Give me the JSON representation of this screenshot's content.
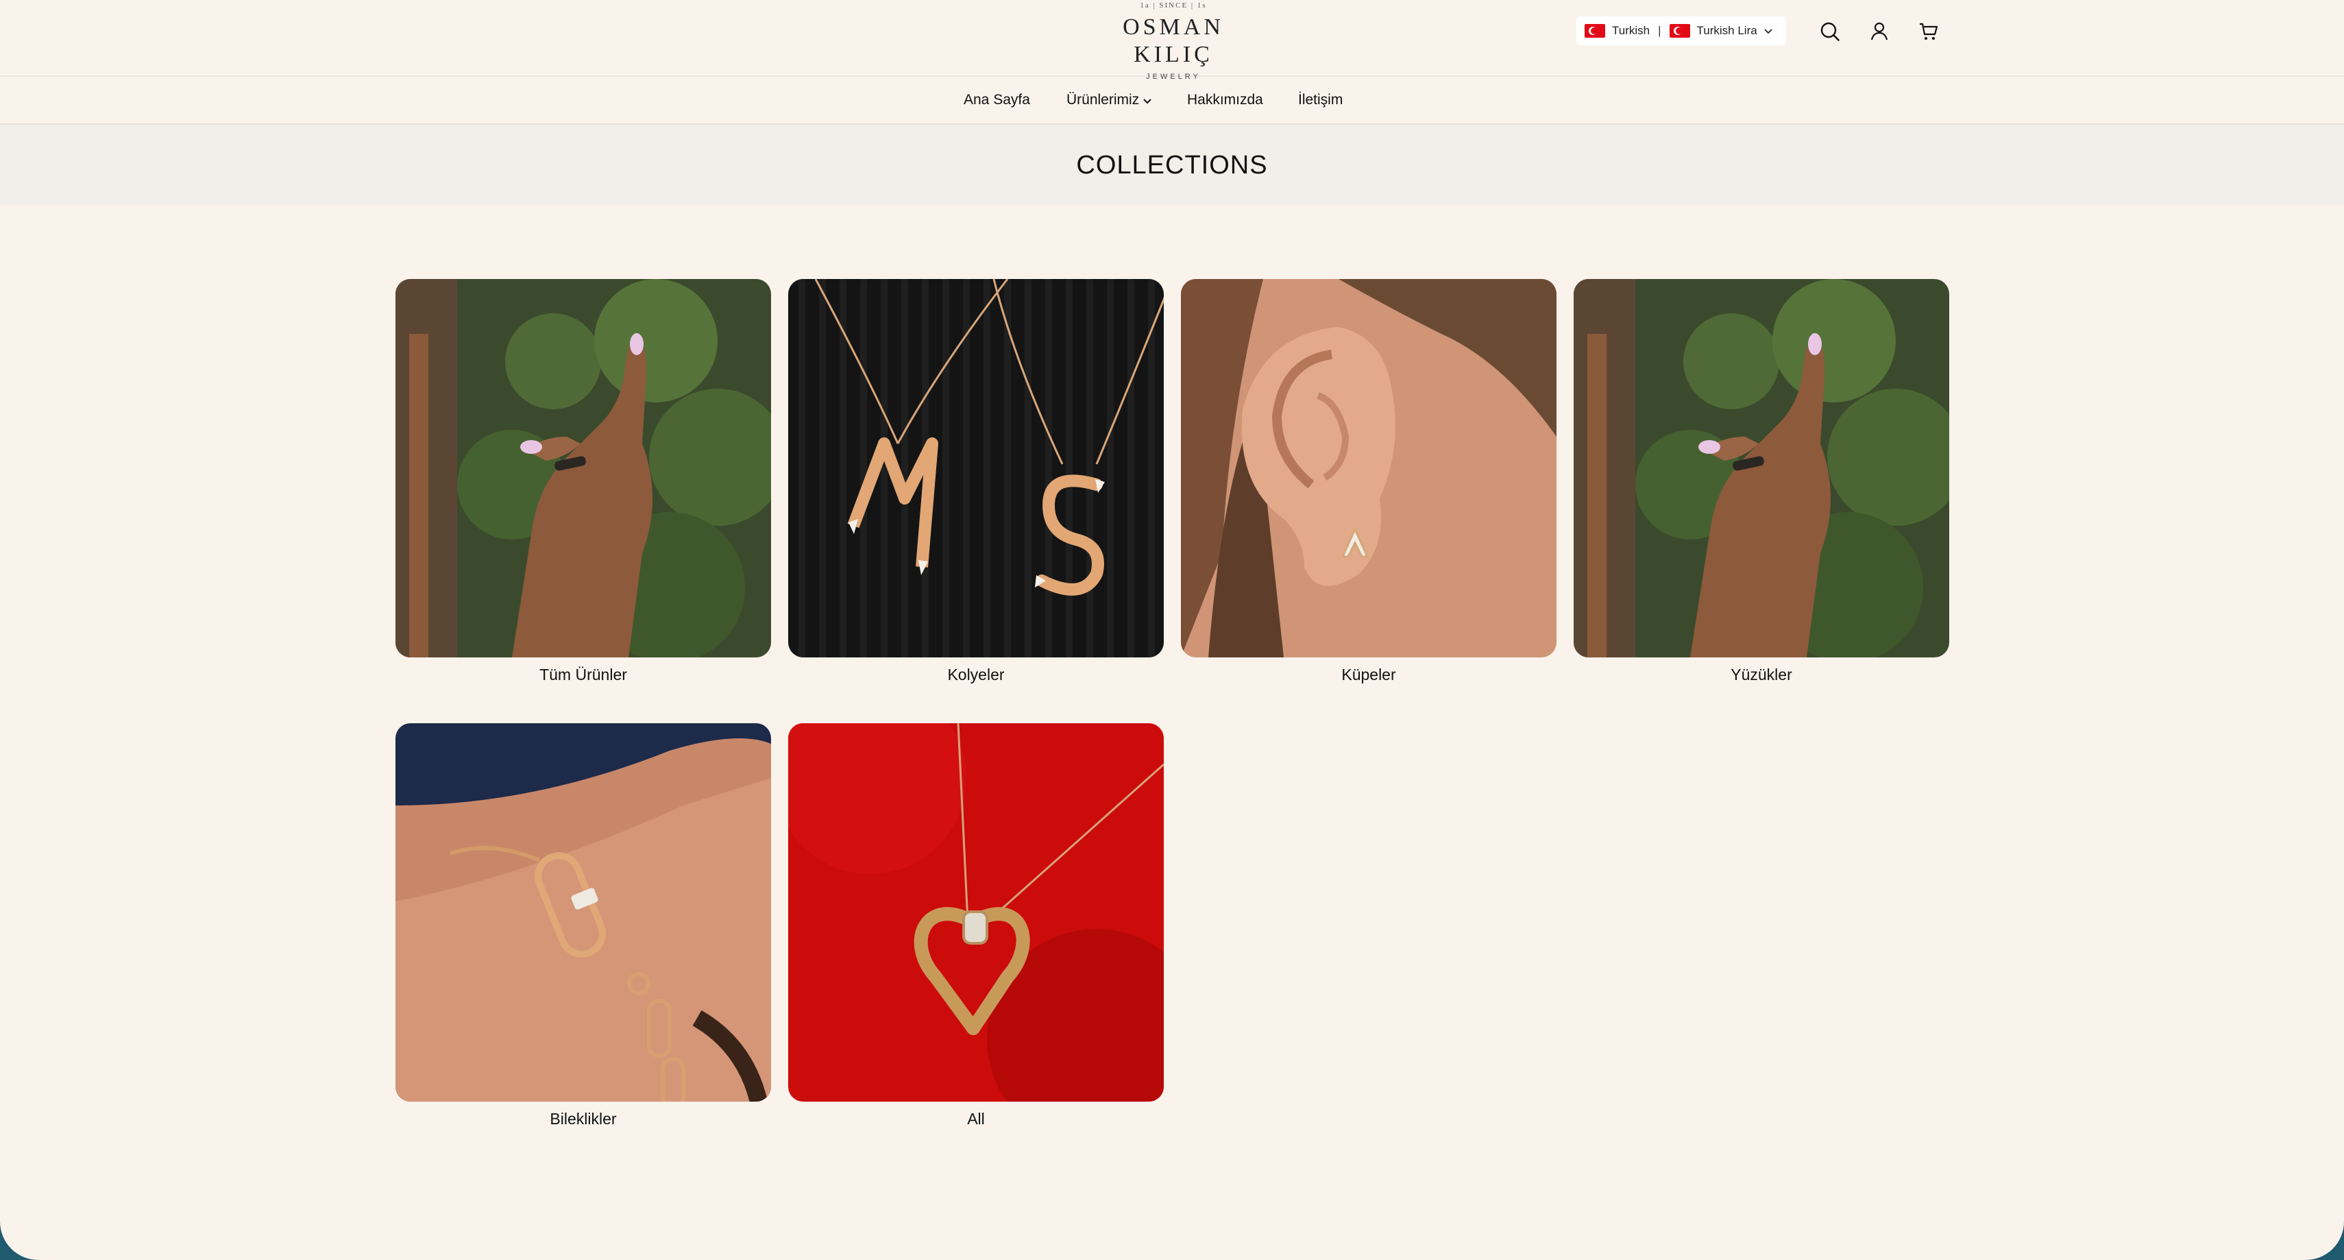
{
  "brand": {
    "since": "1a | SINCE | 1s",
    "name": "OSMAN KILIÇ",
    "sub": "JEWELRY"
  },
  "header": {
    "language": "Turkish",
    "currency": "Turkish Lira",
    "icons": [
      "search-icon",
      "user-icon",
      "cart-icon"
    ]
  },
  "nav": {
    "items": [
      {
        "label": "Ana Sayfa"
      },
      {
        "label": "Ürünlerimiz"
      },
      {
        "label": "Hakkımızda"
      },
      {
        "label": "İletişim"
      }
    ]
  },
  "page": {
    "title": "COLLECTIONS"
  },
  "collections": [
    {
      "label": "Tüm Ürünler"
    },
    {
      "label": "Kolyeler"
    },
    {
      "label": "Küpeler"
    },
    {
      "label": "Yüzükler"
    },
    {
      "label": "Bileklikler"
    },
    {
      "label": "All"
    }
  ],
  "colors": {
    "background": "#f9f3ec",
    "banner": "#f2efea",
    "flag_red": "#e30a17"
  }
}
